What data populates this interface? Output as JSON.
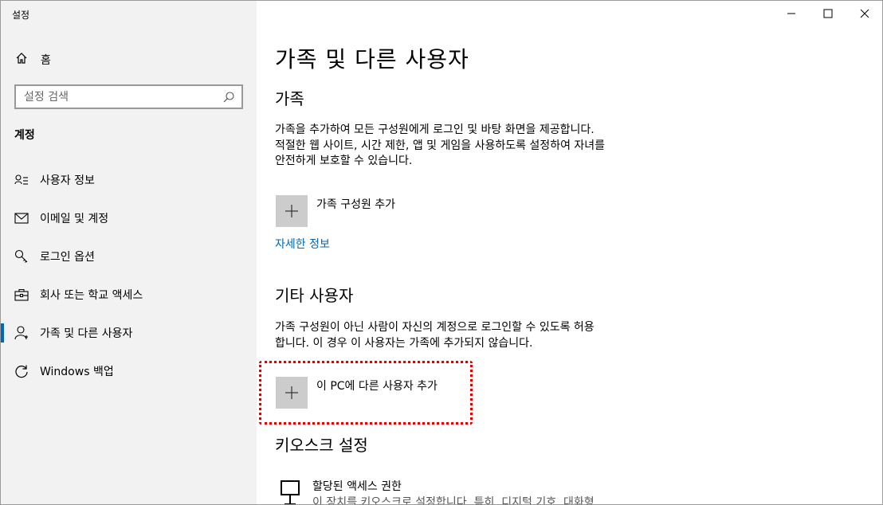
{
  "window": {
    "title": "설정"
  },
  "sidebar": {
    "home_label": "홈",
    "search_placeholder": "설정 검색",
    "section": "계정",
    "items": [
      {
        "label": "사용자 정보",
        "icon": "user-info-icon"
      },
      {
        "label": "이메일 및 계정",
        "icon": "mail-icon"
      },
      {
        "label": "로그인 옵션",
        "icon": "key-icon"
      },
      {
        "label": "회사 또는 학교 액세스",
        "icon": "briefcase-icon"
      },
      {
        "label": "가족 및 다른 사용자",
        "icon": "person-icon",
        "active": true
      },
      {
        "label": "Windows 백업",
        "icon": "sync-icon"
      }
    ]
  },
  "main": {
    "title": "가족 및 다른 사용자",
    "family": {
      "heading": "가족",
      "desc_lines": [
        "가족을 추가하여 모든 구성원에게 로그인 및 바탕 화면을 제공합니다.",
        "적절한 웹 사이트, 시간 제한, 앱 및 게임을 사용하도록 설정하여 자녀를",
        "안전하게 보호할 수 있습니다."
      ],
      "add_label": "가족 구성원 추가",
      "more_info": "자세한 정보"
    },
    "others": {
      "heading": "기타 사용자",
      "desc_lines": [
        "가족 구성원이 아닌 사람이 자신의 계정으로 로그인할 수 있도록 허용",
        "합니다. 이 경우 이 사용자는 가족에 추가되지 않습니다."
      ],
      "add_label": "이 PC에 다른 사용자 추가"
    },
    "kiosk": {
      "heading": "키오스크 설정",
      "item_title": "할당된 액세스 권한",
      "item_desc": "이 장치를 키오스크로 설정합니다. 특히, 디지털 기호, 대화형"
    }
  },
  "colors": {
    "accent": "#0067c0",
    "link": "#0067b8",
    "highlight": "#e00000",
    "sidebar_bg": "#f2f2f2"
  }
}
